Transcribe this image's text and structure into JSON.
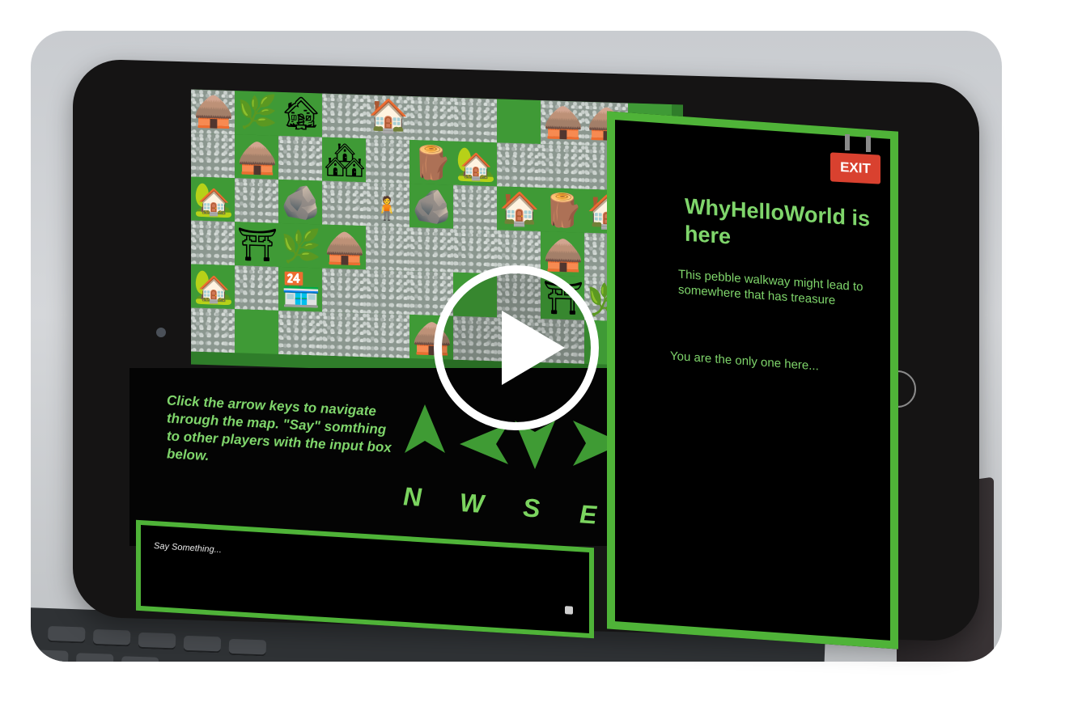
{
  "map": {
    "player_icon": "character-icon"
  },
  "instructions": {
    "text": "Click the arrow keys to navigate through the map. \"Say\" somthing to other players with the input box below."
  },
  "directions": {
    "north": "N",
    "west": "W",
    "south": "S",
    "east": "E"
  },
  "chat": {
    "placeholder": "Say Something...",
    "send_icon": "send-icon"
  },
  "exit": {
    "label": "EXIT"
  },
  "location": {
    "title": "WhyHelloWorld is here",
    "description": "This pebble walkway might lead to somewhere that has treasure",
    "status": "You are the only one here..."
  },
  "video": {
    "play_icon": "play-icon"
  },
  "colors": {
    "accent": "#4fb338",
    "text_green": "#7fd56b",
    "exit_red": "#d9412f",
    "screen_bg": "#000000"
  }
}
